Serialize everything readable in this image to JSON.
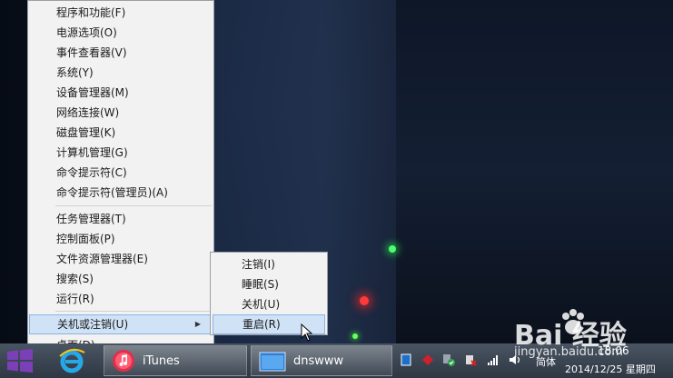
{
  "menu": {
    "items": [
      {
        "label": "程序和功能(F)"
      },
      {
        "label": "电源选项(O)"
      },
      {
        "label": "事件查看器(V)"
      },
      {
        "label": "系统(Y)"
      },
      {
        "label": "设备管理器(M)"
      },
      {
        "label": "网络连接(W)"
      },
      {
        "label": "磁盘管理(K)"
      },
      {
        "label": "计算机管理(G)"
      },
      {
        "label": "命令提示符(C)"
      },
      {
        "label": "命令提示符(管理员)(A)"
      },
      {
        "label": "任务管理器(T)"
      },
      {
        "label": "控制面板(P)"
      },
      {
        "label": "文件资源管理器(E)"
      },
      {
        "label": "搜索(S)"
      },
      {
        "label": "运行(R)"
      },
      {
        "label": "关机或注销(U)",
        "highlighted": true,
        "submenu": true
      },
      {
        "label": "桌面(D)"
      }
    ]
  },
  "submenu": {
    "items": [
      {
        "label": "注销(I)"
      },
      {
        "label": "睡眠(S)"
      },
      {
        "label": "关机(U)"
      },
      {
        "label": "重启(R)",
        "highlighted": true
      }
    ]
  },
  "taskbar": {
    "itunes_label": "iTunes",
    "dnswww_label": "dnswww",
    "ime_label": "简体",
    "time": "18:06",
    "date": "2014/12/25 星期四"
  },
  "watermark": {
    "brand": "Bai 经验",
    "url": "jingyan.baidu.com"
  },
  "colors": {
    "menu_bg": "#f2f2f2",
    "highlight": "#cfe2f6",
    "highlight_border": "#8db2e3",
    "start_purple": "#7b3fb8"
  }
}
